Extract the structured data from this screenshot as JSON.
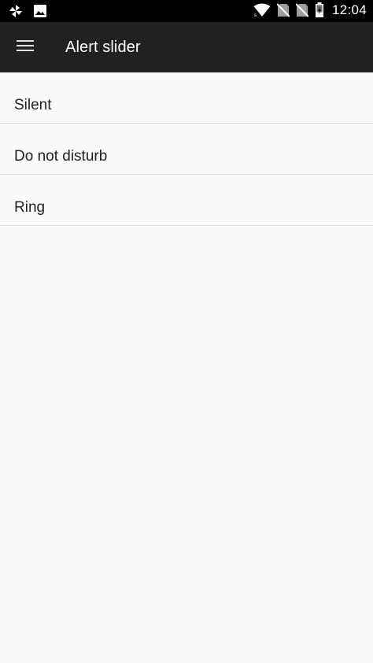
{
  "status_bar": {
    "left_icons": [
      "pinwheel-icon",
      "image-icon"
    ],
    "right_icons": [
      "wifi-icon",
      "no-sim-icon",
      "no-sim-icon",
      "battery-charging-icon"
    ],
    "time": "12:04"
  },
  "app_bar": {
    "menu_icon": "hamburger-menu-icon",
    "title": "Alert slider"
  },
  "list": {
    "items": [
      {
        "label": "Silent"
      },
      {
        "label": "Do not disturb"
      },
      {
        "label": "Ring"
      }
    ]
  },
  "colors": {
    "status_bar_bg": "#000000",
    "app_bar_bg": "#212121",
    "page_bg": "#fafafa",
    "divider": "#dedede",
    "text_primary": "#212121",
    "text_on_dark": "#ffffff"
  }
}
